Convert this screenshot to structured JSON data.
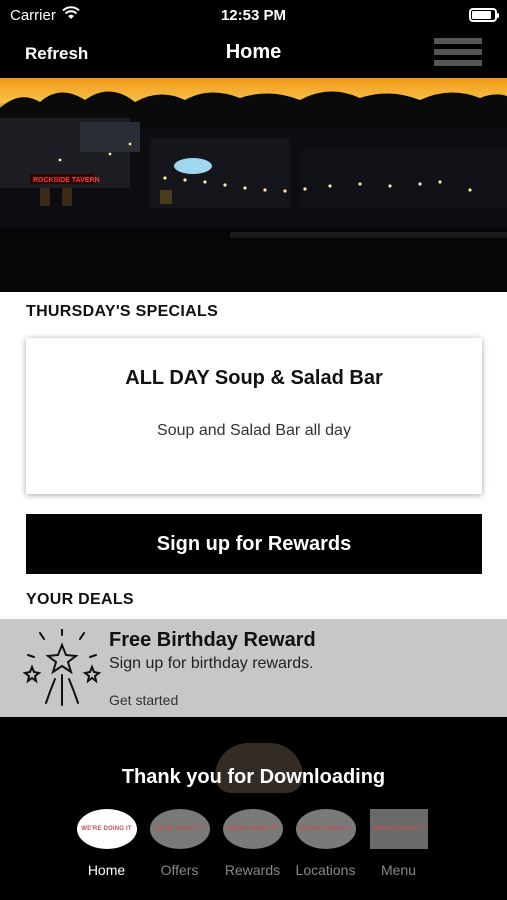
{
  "status": {
    "carrier": "Carrier",
    "time": "12:53 PM"
  },
  "nav": {
    "refresh_label": "Refresh",
    "title": "Home"
  },
  "hero": {
    "signs": [
      "ROCKSIDE TAVERN"
    ]
  },
  "specials": {
    "section_title": "THURSDAY'S SPECIALS",
    "card_title": "ALL DAY Soup & Salad Bar",
    "card_desc": "Soup and Salad Bar all day"
  },
  "rewards": {
    "button_label": "Sign up for Rewards"
  },
  "deals": {
    "section_title": "YOUR DEALS",
    "items": [
      {
        "title": "Free Birthday Reward",
        "subtitle": "Sign up for birthday rewards.",
        "cta": "Get started",
        "icon": "fireworks-icon"
      }
    ]
  },
  "footer": {
    "thanks": "Thank you for Downloading",
    "logo_text": "WE'RE DOING IT",
    "tabs": [
      {
        "label": "Home",
        "active": true
      },
      {
        "label": "Offers",
        "active": false
      },
      {
        "label": "Rewards",
        "active": false
      },
      {
        "label": "Locations",
        "active": false
      },
      {
        "label": "Menu",
        "active": false
      }
    ]
  },
  "colors": {
    "accent": "#000000",
    "deal_bg": "#c7c7c7",
    "sunset": "#f2a21c"
  }
}
